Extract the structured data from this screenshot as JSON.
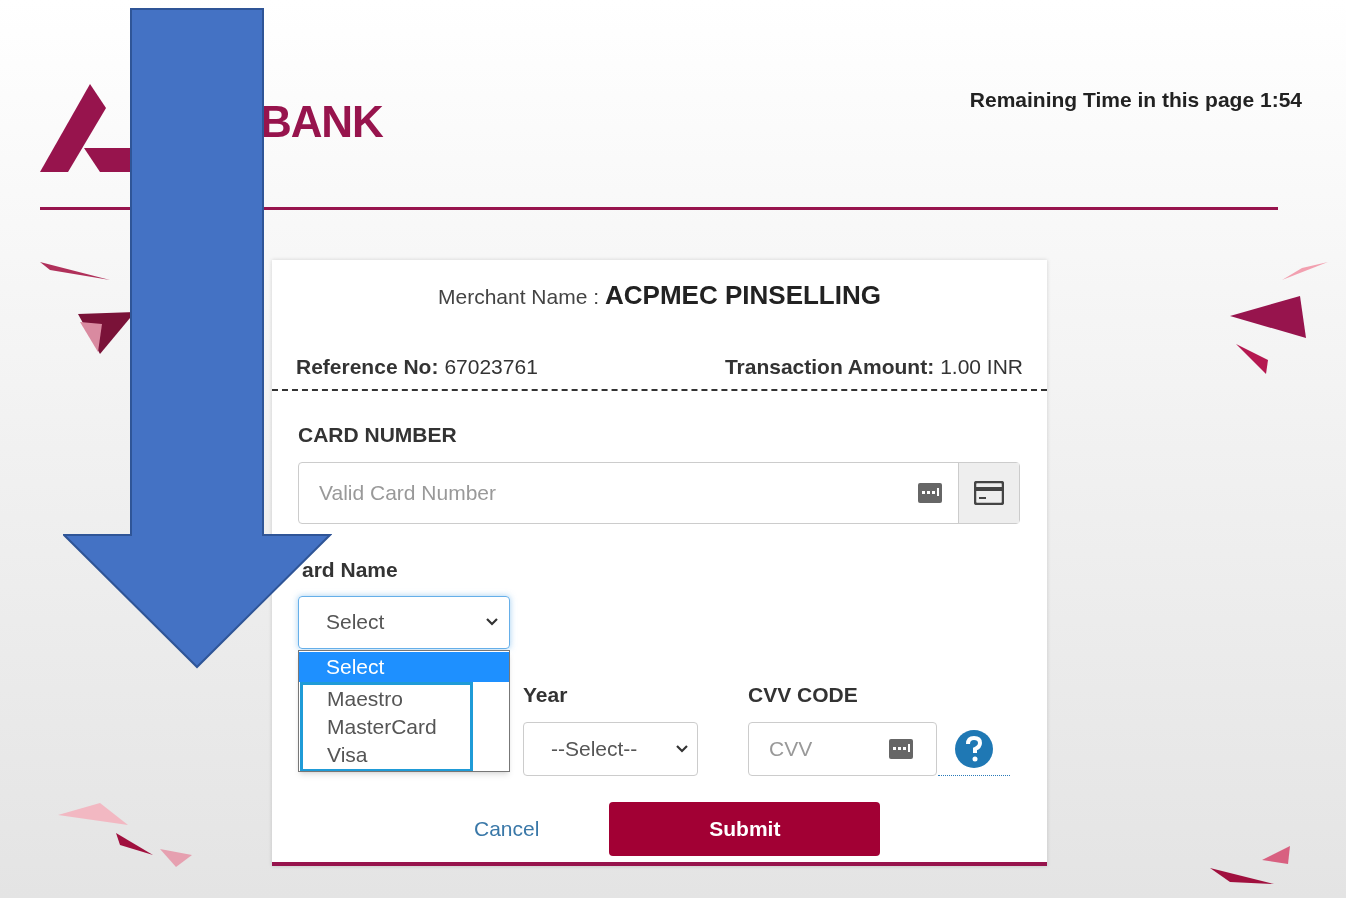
{
  "header": {
    "logo_text": "BANK",
    "timer": "Remaining Time in this page 1:54"
  },
  "merchant": {
    "label": "Merchant Name :",
    "value": "ACPMEC PINSELLING"
  },
  "reference": {
    "label": "Reference No:",
    "value": "67023761"
  },
  "amount": {
    "label": "Transaction Amount:",
    "value": "1.00 INR"
  },
  "card_number": {
    "label": "CARD NUMBER",
    "placeholder": "Valid Card Number"
  },
  "card_name": {
    "label": "ard Name",
    "value": "Select",
    "expanded": true,
    "options": [
      {
        "label": "Select",
        "selected": true
      },
      {
        "label": "Maestro",
        "selected": false
      },
      {
        "label": "MasterCard",
        "selected": false
      },
      {
        "label": "Visa",
        "selected": false
      }
    ]
  },
  "year": {
    "label": "Year",
    "value": "--Select--"
  },
  "cvv": {
    "label": "CVV CODE",
    "placeholder": "CVV"
  },
  "buttons": {
    "cancel": "Cancel",
    "submit": "Submit"
  }
}
